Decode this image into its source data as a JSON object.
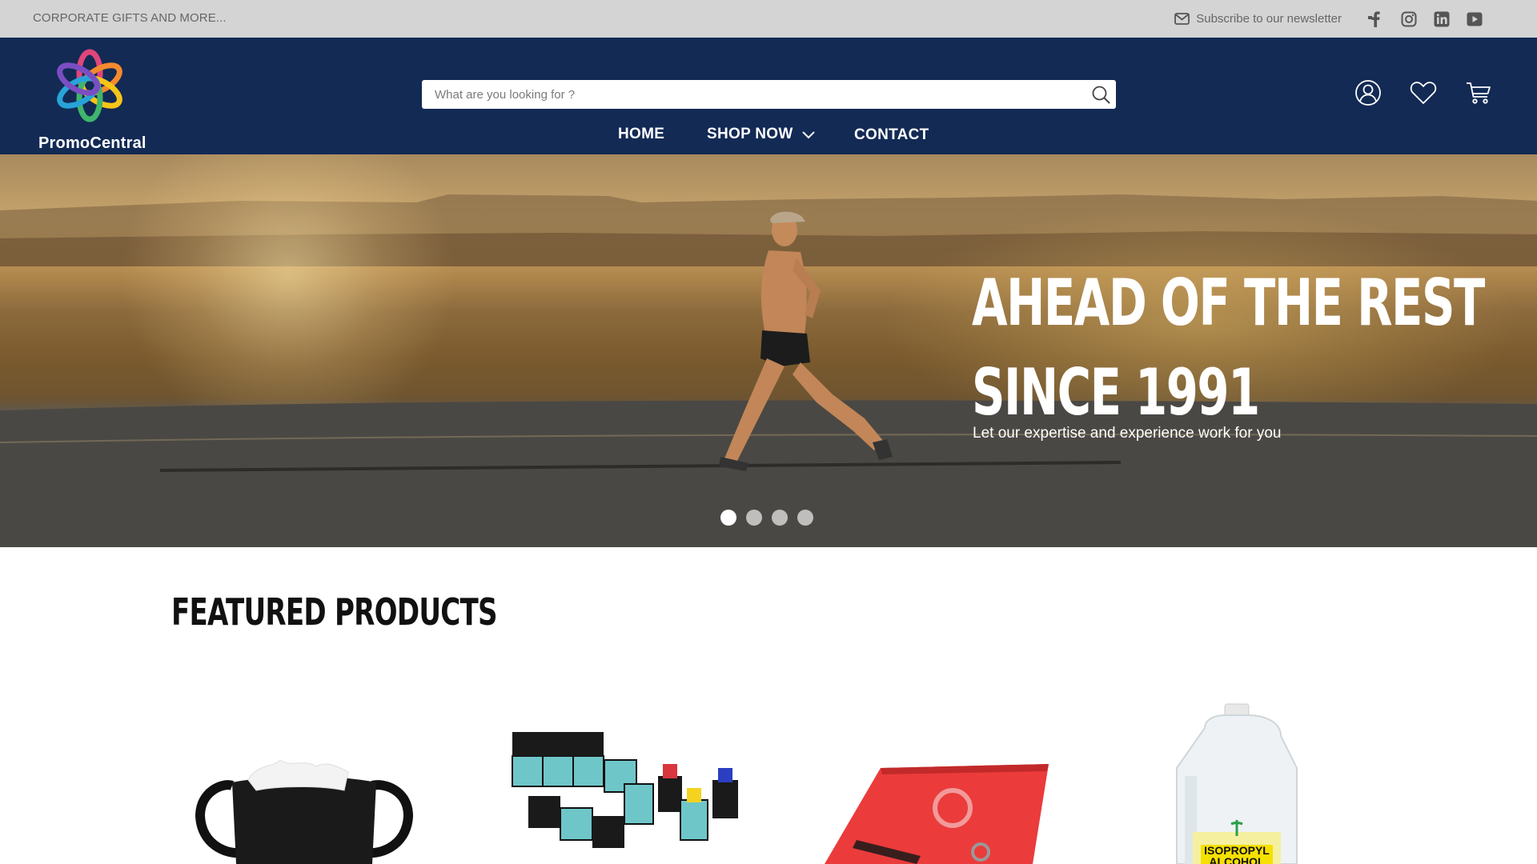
{
  "topbar": {
    "tagline": "CORPORATE GIFTS AND MORE...",
    "newsletter_label": "Subscribe to our newsletter",
    "social": [
      "facebook-icon",
      "instagram-icon",
      "linkedin-icon",
      "youtube-icon"
    ]
  },
  "header": {
    "brand_name": "PromoCentral",
    "search_placeholder": "What are you looking for ?",
    "search_value": "",
    "nav": {
      "home": "HOME",
      "shop": "SHOP NOW",
      "contact": "CONTACT"
    },
    "icons": [
      "user-icon",
      "heart-icon",
      "cart-icon"
    ]
  },
  "hero": {
    "title_line1": "AHEAD OF THE REST",
    "title_line2": "SINCE 1991",
    "subtitle": "Let our expertise and experience work for you",
    "slide_count": 4,
    "active_slide": 1
  },
  "featured": {
    "title": "FEATURED PRODUCTS",
    "products": [
      {
        "image": "face-mask"
      },
      {
        "image": "branded-cubes-highlighters"
      },
      {
        "image": "red-notebook"
      },
      {
        "image": "isopropyl-alcohol-jug",
        "label_line1": "ISOPROPYL",
        "label_line2": "ALCOHOL"
      }
    ]
  },
  "colors": {
    "topbar_bg": "#d4d4d4",
    "header_bg": "#132a55",
    "text_light": "#ffffff"
  }
}
